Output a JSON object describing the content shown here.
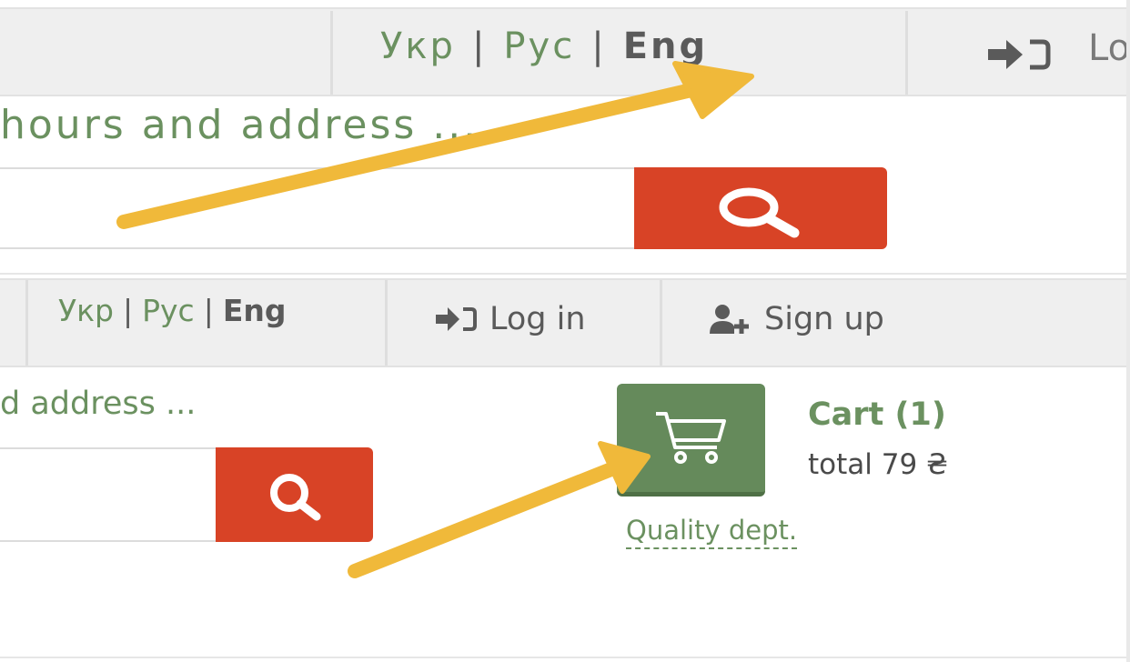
{
  "zoomed_header": {
    "lang_ukr": "Укр",
    "lang_rus": "Рус",
    "lang_eng": "Eng",
    "separator": "|",
    "login_label_partial": "Lo"
  },
  "zoomed_search": {
    "hint": "hours and address ..."
  },
  "header": {
    "lang_ukr": "Укр",
    "lang_rus": "Рус",
    "lang_eng": "Eng",
    "separator": "|",
    "login_label": "Log in",
    "signup_label": "Sign up"
  },
  "search": {
    "hint": "d address ..."
  },
  "cart": {
    "title": "Cart (1)",
    "total": "total 79 ₴"
  },
  "quality_link": "Quality dept.",
  "colors": {
    "accent_green": "#6b9160",
    "search_red": "#d84326",
    "cart_green": "#658a5b",
    "arrow_yellow": "#f0b93a"
  }
}
